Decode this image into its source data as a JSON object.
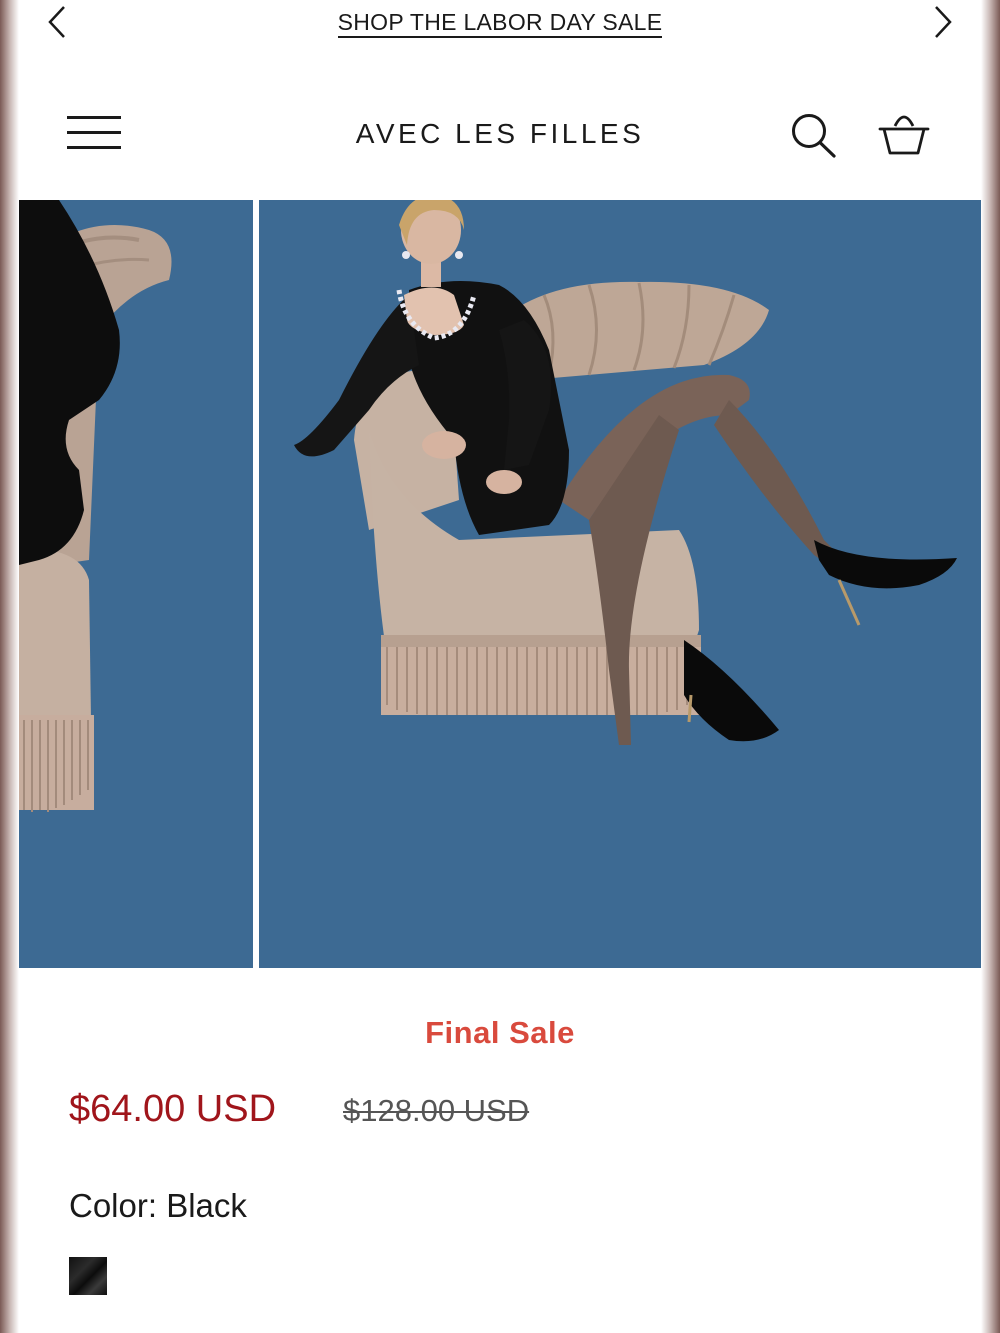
{
  "announcement": {
    "text": "SHOP THE LABOR DAY SALE",
    "prev_icon": "chevron-left-icon",
    "next_icon": "chevron-right-icon"
  },
  "header": {
    "brand": "AVEC LES FILLES",
    "menu_icon": "hamburger-menu-icon",
    "search_icon": "search-icon",
    "cart_icon": "basket-icon"
  },
  "gallery": {
    "background_color": "#3d6a93",
    "images": [
      {
        "name": "product-photo-side",
        "depicts": "velvet dress on beige fringed armchair"
      },
      {
        "name": "product-photo-main",
        "depicts": "model in black velvet mini dress seated in armchair"
      }
    ]
  },
  "product": {
    "badge": "Final Sale",
    "sale_price": "$64.00 USD",
    "original_price": "$128.00 USD",
    "color_label": "Color: Black",
    "swatches": [
      {
        "color": "Black",
        "hex": "#111111"
      }
    ]
  },
  "colors": {
    "sale_badge": "#d94a3d",
    "sale_price": "#a0151b",
    "text": "#1a1a1a"
  }
}
